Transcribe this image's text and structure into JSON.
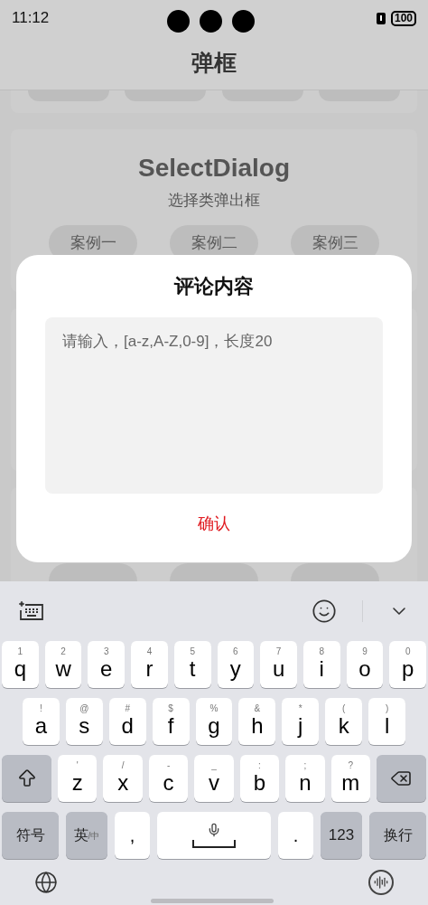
{
  "status_bar": {
    "time": "11:12",
    "battery": "100"
  },
  "header": {
    "title": "弹框"
  },
  "card": {
    "title": "SelectDialog",
    "subtitle": "选择类弹出框",
    "buttons": [
      "案例一",
      "案例二",
      "案例三"
    ]
  },
  "dialog": {
    "title": "评论内容",
    "input": {
      "placeholder": "请输入，[a-z,A-Z,0-9]，长度20"
    },
    "confirm": "确认"
  },
  "keyboard": {
    "rows": [
      [
        {
          "kind": "char",
          "key": "q",
          "hint": "1"
        },
        {
          "kind": "char",
          "key": "w",
          "hint": "2"
        },
        {
          "kind": "char",
          "key": "e",
          "hint": "3"
        },
        {
          "kind": "char",
          "key": "r",
          "hint": "4"
        },
        {
          "kind": "char",
          "key": "t",
          "hint": "5"
        },
        {
          "kind": "char",
          "key": "y",
          "hint": "6"
        },
        {
          "kind": "char",
          "key": "u",
          "hint": "7"
        },
        {
          "kind": "char",
          "key": "i",
          "hint": "8"
        },
        {
          "kind": "char",
          "key": "o",
          "hint": "9"
        },
        {
          "kind": "char",
          "key": "p",
          "hint": "0"
        }
      ],
      [
        {
          "kind": "char",
          "key": "a",
          "hint": "!"
        },
        {
          "kind": "char",
          "key": "s",
          "hint": "@"
        },
        {
          "kind": "char",
          "key": "d",
          "hint": "#"
        },
        {
          "kind": "char",
          "key": "f",
          "hint": "$"
        },
        {
          "kind": "char",
          "key": "g",
          "hint": "%"
        },
        {
          "kind": "char",
          "key": "h",
          "hint": "&"
        },
        {
          "kind": "char",
          "key": "j",
          "hint": "*"
        },
        {
          "kind": "char",
          "key": "k",
          "hint": "("
        },
        {
          "kind": "char",
          "key": "l",
          "hint": ")"
        }
      ],
      [
        {
          "kind": "shift"
        },
        {
          "kind": "char",
          "key": "z",
          "hint": "'"
        },
        {
          "kind": "char",
          "key": "x",
          "hint": "/"
        },
        {
          "kind": "char",
          "key": "c",
          "hint": "-"
        },
        {
          "kind": "char",
          "key": "v",
          "hint": "_"
        },
        {
          "kind": "char",
          "key": "b",
          "hint": ":"
        },
        {
          "kind": "char",
          "key": "n",
          "hint": ";"
        },
        {
          "kind": "char",
          "key": "m",
          "hint": "?"
        },
        {
          "kind": "backspace"
        }
      ]
    ],
    "bottom_row": [
      {
        "kind": "symbols",
        "key": "符号"
      },
      {
        "kind": "lang",
        "key": "英",
        "sub": "/中"
      },
      {
        "kind": "punct",
        "key": ","
      },
      {
        "kind": "space"
      },
      {
        "kind": "punct",
        "key": "."
      },
      {
        "kind": "numbers",
        "key": "123"
      },
      {
        "kind": "enter",
        "key": "换行"
      }
    ]
  }
}
